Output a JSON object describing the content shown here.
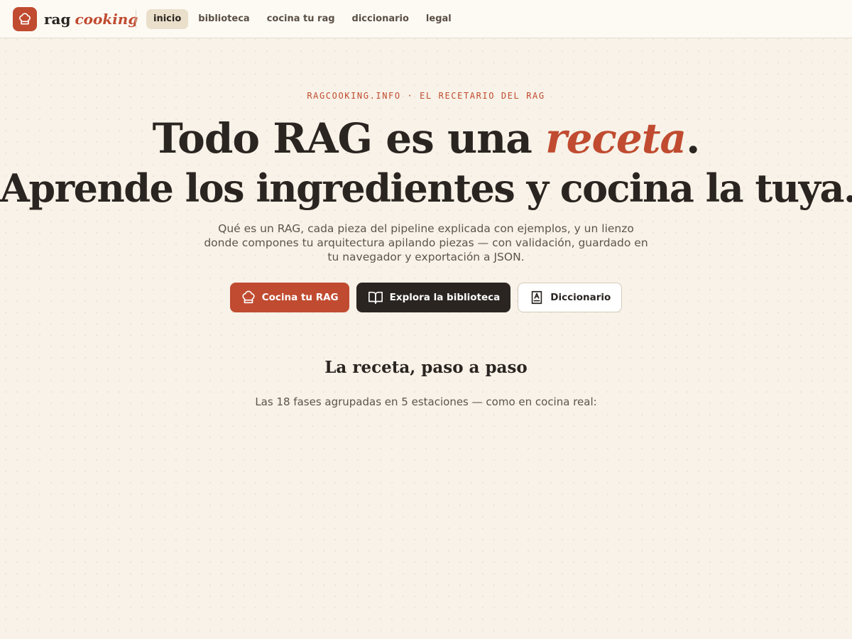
{
  "brand": {
    "name_part1": "rag",
    "name_part2": "cooking",
    "logo_icon": "chef-hat-icon",
    "accent_color": "#c04b30"
  },
  "nav": {
    "items": [
      {
        "label": "inicio",
        "active": true
      },
      {
        "label": "biblioteca",
        "active": false
      },
      {
        "label": "cocina tu rag",
        "active": false
      },
      {
        "label": "diccionario",
        "active": false
      },
      {
        "label": "legal",
        "active": false
      }
    ]
  },
  "hero": {
    "eyebrow": "RAGCOOKING.INFO · EL RECETARIO DEL RAG",
    "title_line1_before": "Todo RAG es una",
    "title_line1_accent": "receta",
    "title_line1_after": ".",
    "title_line2": "Aprende los ingredientes y cocina la tuya.",
    "description": "Qué es un RAG, cada pieza del pipeline explicada con ejemplos, y un lienzo donde compones tu arquitectura apilando piezas — con validación, guardado en tu navegador y exportación a JSON."
  },
  "cta": {
    "primary": {
      "label": "Cocina tu RAG",
      "icon": "chef-hat-icon"
    },
    "secondary": {
      "label": "Explora la biblioteca",
      "icon": "open-book-icon"
    },
    "tertiary": {
      "label": "Diccionario",
      "icon": "dictionary-icon"
    }
  },
  "steps_section": {
    "title": "La receta, paso a paso",
    "subtitle": "Las 18 fases agrupadas en 5 estaciones — como en cocina real:"
  },
  "colors": {
    "background": "#f8f2e8",
    "text": "#2a2521",
    "accent": "#c04b30",
    "dark_button": "#2a2521"
  }
}
